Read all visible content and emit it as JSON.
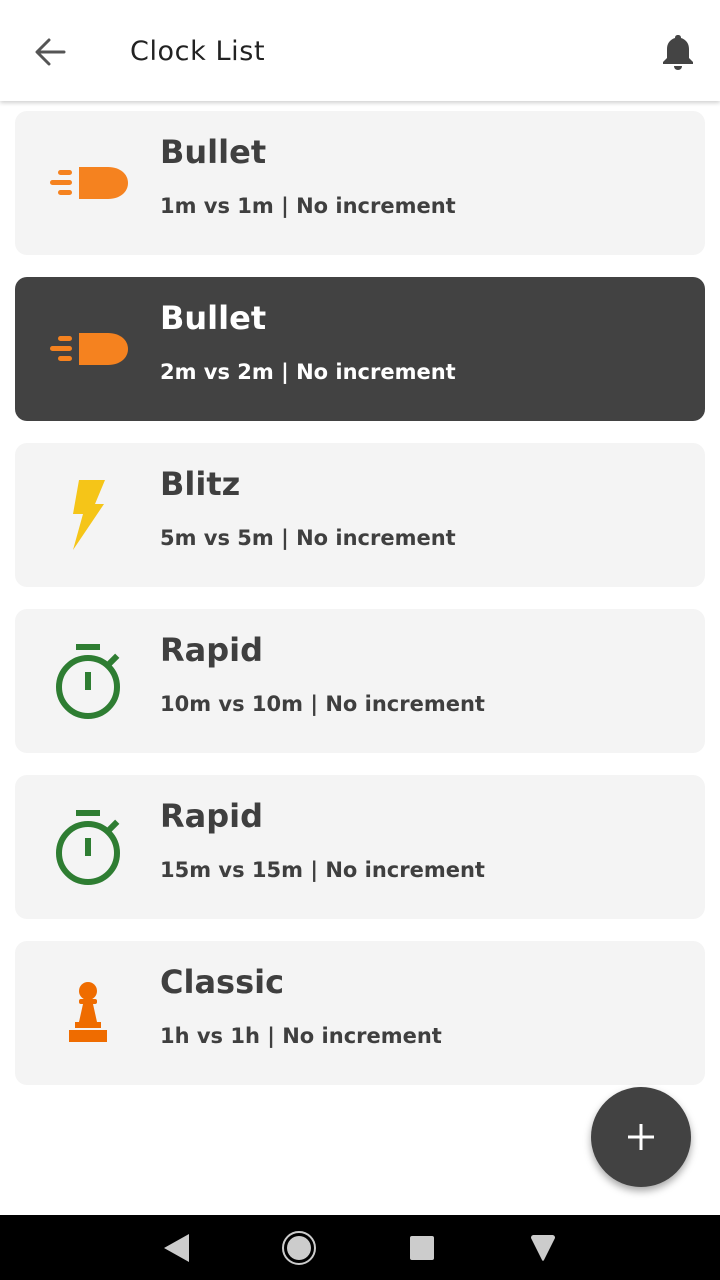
{
  "header": {
    "title": "Clock List"
  },
  "icons": {
    "back": "arrow-left-icon",
    "notifications": "bell-icon",
    "add": "plus-icon"
  },
  "colors": {
    "bullet_icon": "#f5821f",
    "blitz_icon": "#f5c518",
    "rapid_icon": "#2e7d32",
    "classic_icon": "#ef6c00",
    "selected_card": "#424242",
    "card": "#f4f4f4"
  },
  "clocks": [
    {
      "name": "Bullet",
      "detail": "1m vs 1m | No increment",
      "icon": "bullet-icon",
      "selected": false
    },
    {
      "name": "Bullet",
      "detail": "2m vs 2m | No increment",
      "icon": "bullet-icon",
      "selected": true
    },
    {
      "name": "Blitz",
      "detail": "5m vs 5m | No increment",
      "icon": "lightning-icon",
      "selected": false
    },
    {
      "name": "Rapid",
      "detail": "10m vs 10m | No increment",
      "icon": "stopwatch-icon",
      "selected": false
    },
    {
      "name": "Rapid",
      "detail": "15m vs 15m | No increment",
      "icon": "stopwatch-icon",
      "selected": false
    },
    {
      "name": "Classic",
      "detail": "1h vs 1h | No increment",
      "icon": "pawn-icon",
      "selected": false
    }
  ],
  "system_nav": [
    "back-nav-icon",
    "home-nav-icon",
    "recents-nav-icon",
    "assist-nav-icon"
  ]
}
